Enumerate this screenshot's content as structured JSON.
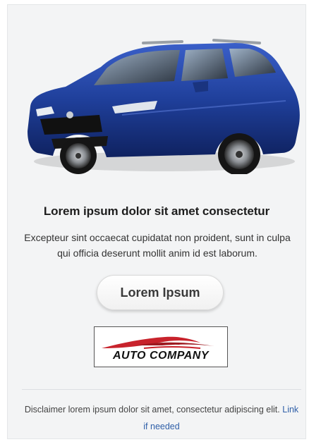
{
  "ad": {
    "image": {
      "icon": "car-photo",
      "body_color": "#1f3f9a",
      "description_alt": "Blue hatchback car"
    },
    "headline": "Lorem ipsum dolor sit amet consectetur",
    "body": "Excepteur sint occaecat cupidatat non proident, sunt in culpa qui officia deserunt mollit anim id est laborum.",
    "cta_label": "Lorem Ipsum",
    "logo": {
      "text": "AUTO COMPANY",
      "swoosh_color": "#c8232c"
    },
    "disclaimer": {
      "text": "Disclaimer lorem ipsum dolor sit amet, consectetur adipiscing elit.",
      "link_text": "Link if needed",
      "link_color": "#2f5fa8"
    }
  }
}
